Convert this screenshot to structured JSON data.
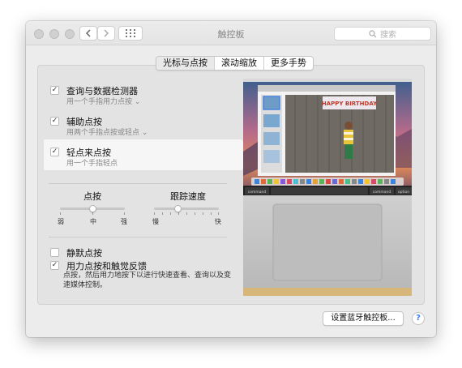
{
  "window": {
    "title": "触控板"
  },
  "search": {
    "placeholder": "搜索"
  },
  "tabs": [
    "光标与点按",
    "滚动缩放",
    "更多手势"
  ],
  "options": [
    {
      "title": "查询与数据检测器",
      "sub": "用一个手指用力点按 ⌄",
      "checked": true
    },
    {
      "title": "辅助点按",
      "sub": "用两个手指点按或轻点 ⌄",
      "checked": true
    },
    {
      "title": "轻点来点按",
      "sub": "用一个手指轻点",
      "checked": true
    }
  ],
  "sliders": {
    "click": {
      "label": "点按",
      "min": "弱",
      "mid": "中",
      "max": "强",
      "value": 0.5
    },
    "tracking": {
      "label": "跟踪速度",
      "min": "慢",
      "max": "快",
      "value": 0.35
    }
  },
  "bottom_options": [
    {
      "title": "静默点按",
      "checked": false
    },
    {
      "title": "用力点按和触觉反馈",
      "checked": true
    }
  ],
  "force_desc": "点按，然后用力地按下以进行快速查看、查询以及变速媒体控制。",
  "preview": {
    "banner": "HAPPY BIRTHDAY",
    "keys": [
      "command",
      "command",
      "option"
    ]
  },
  "buttons": {
    "setup": "设置蓝牙触控板...",
    "help": "?"
  }
}
